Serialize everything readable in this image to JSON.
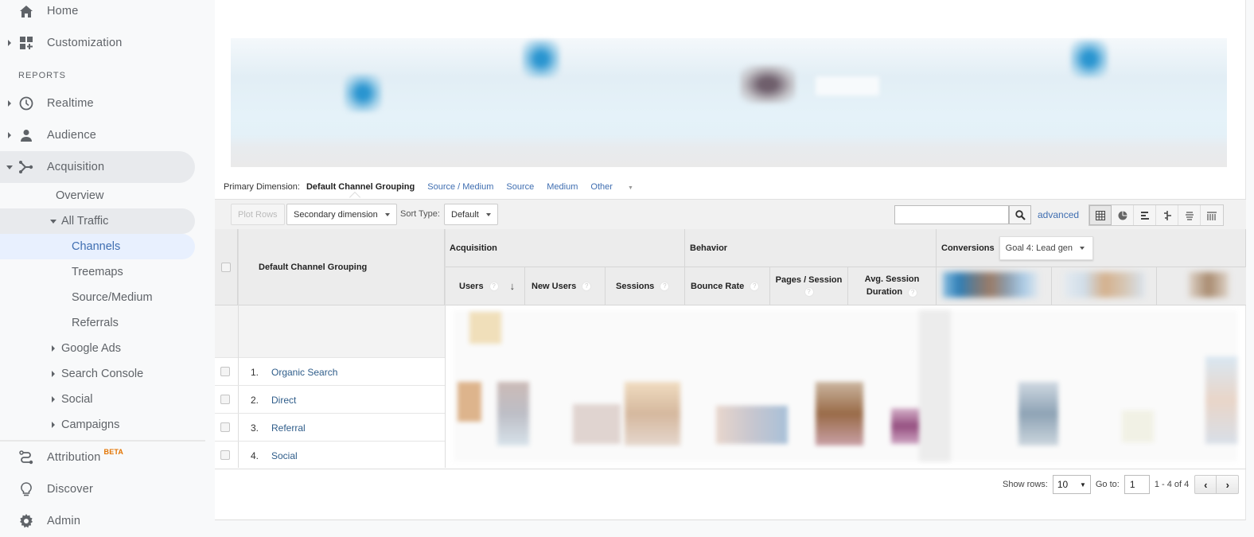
{
  "sidebar": {
    "home": "Home",
    "customization": "Customization",
    "reports_header": "REPORTS",
    "realtime": "Realtime",
    "audience": "Audience",
    "acquisition": "Acquisition",
    "acq_children": {
      "overview": "Overview",
      "all_traffic": "All Traffic",
      "channels": "Channels",
      "treemaps": "Treemaps",
      "source_medium": "Source/Medium",
      "referrals": "Referrals",
      "google_ads": "Google Ads",
      "search_console": "Search Console",
      "social": "Social",
      "campaigns": "Campaigns"
    },
    "attribution": "Attribution",
    "attribution_badge": "BETA",
    "discover": "Discover",
    "admin": "Admin"
  },
  "primary_dimension": {
    "label": "Primary Dimension:",
    "current": "Default Channel Grouping",
    "options": [
      "Source / Medium",
      "Source",
      "Medium",
      "Other"
    ]
  },
  "toolbar": {
    "plot_rows": "Plot Rows",
    "secondary_dimension": "Secondary dimension",
    "sort_type_label": "Sort Type:",
    "sort_type_value": "Default",
    "search_value": "",
    "advanced": "advanced"
  },
  "table": {
    "dimension_header": "Default Channel Grouping",
    "groups": {
      "acquisition": "Acquisition",
      "behavior": "Behavior",
      "conversions": "Conversions",
      "goal_select": "Goal 4: Lead gen"
    },
    "columns": {
      "users": "Users",
      "new_users": "New Users",
      "sessions": "Sessions",
      "bounce_rate": "Bounce Rate",
      "pages_session": "Pages / Session",
      "avg_session_1": "Avg. Session",
      "avg_session_2": "Duration"
    },
    "help_glyph": "?",
    "rows": [
      {
        "num": "1.",
        "channel": "Organic Search"
      },
      {
        "num": "2.",
        "channel": "Direct"
      },
      {
        "num": "3.",
        "channel": "Referral"
      },
      {
        "num": "4.",
        "channel": "Social"
      }
    ]
  },
  "footer": {
    "show_rows_label": "Show rows:",
    "show_rows_value": "10",
    "goto_label": "Go to:",
    "goto_value": "1",
    "range": "1 - 4 of 4",
    "prev": "‹",
    "next": "›"
  },
  "colors": {
    "accent_blue": "#3f6eb1",
    "active_nav_bg": "#e8f0fe",
    "beta": "#e37400"
  }
}
